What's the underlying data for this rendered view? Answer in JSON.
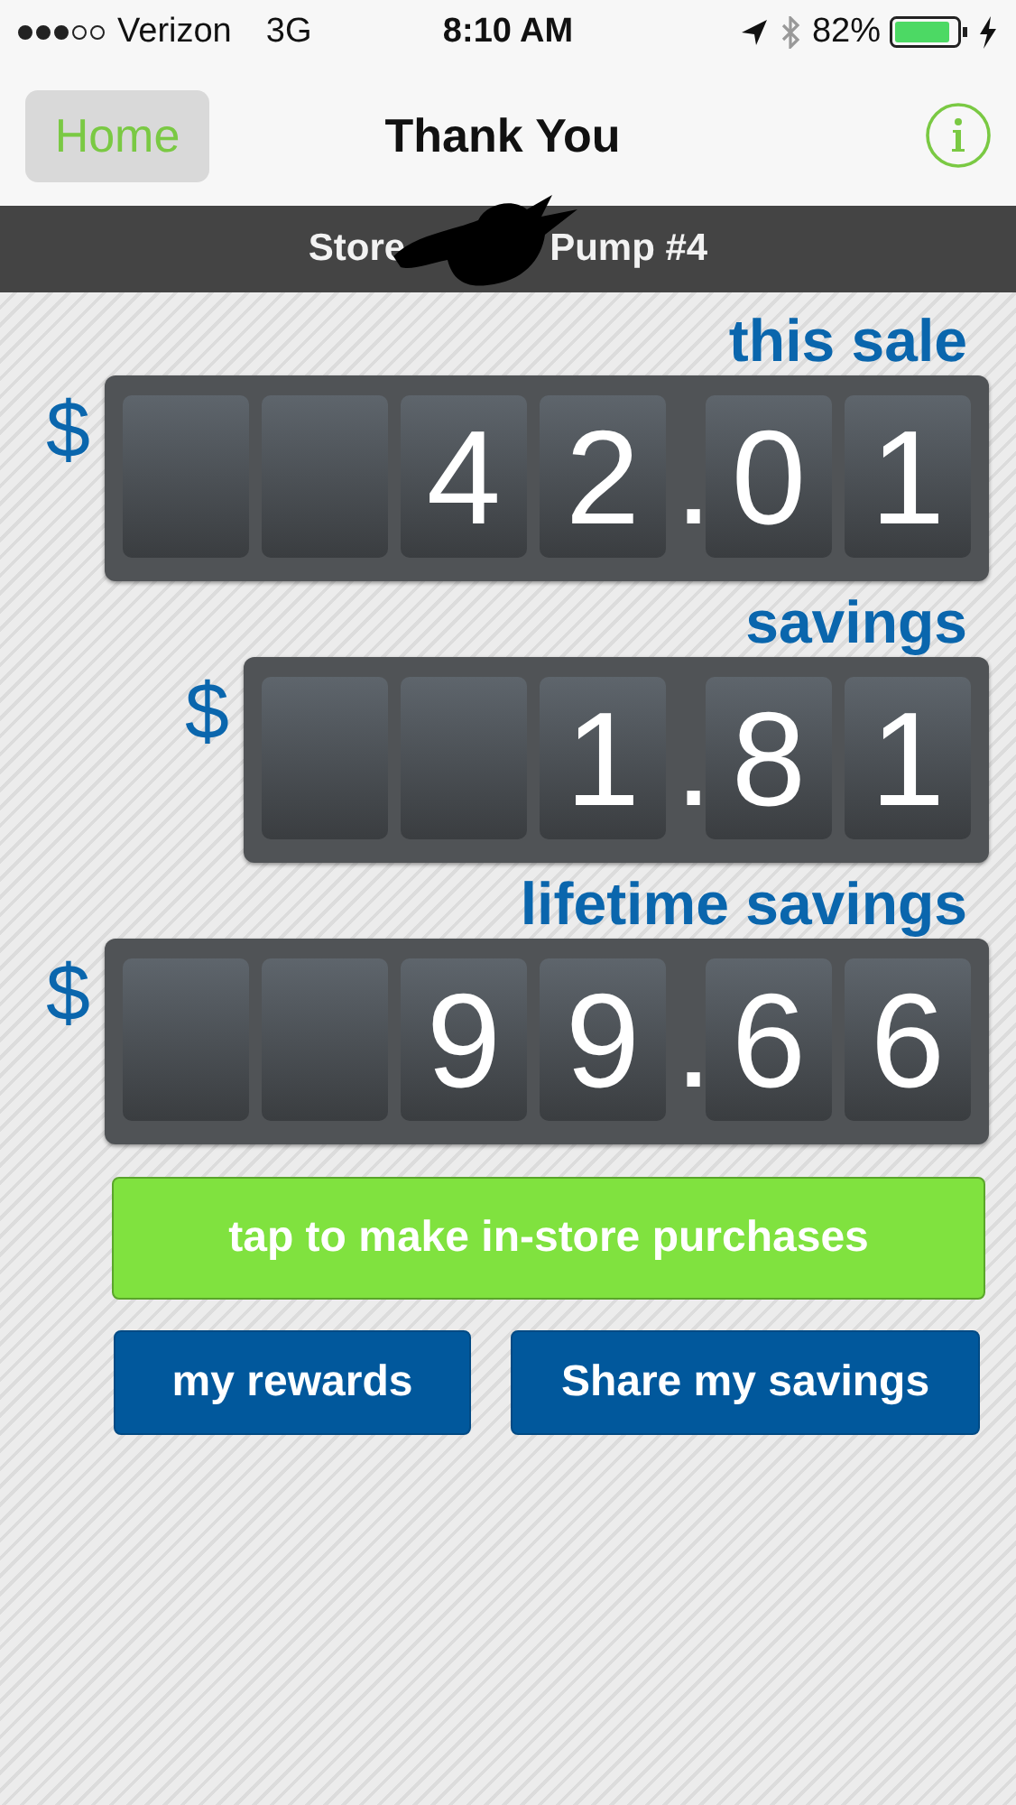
{
  "status_bar": {
    "signal_dots": [
      {
        "filled": true
      },
      {
        "filled": true
      },
      {
        "filled": true
      },
      {
        "filled": false
      },
      {
        "filled": false
      }
    ],
    "carrier": "Verizon",
    "network": "3G",
    "time": "8:10 AM",
    "battery_percent": "82%"
  },
  "nav_bar": {
    "back_button": "Home",
    "title": "Thank You"
  },
  "location_bar": {
    "store": "Store",
    "pump": "Pump #4"
  },
  "counters": [
    {
      "label": "this sale",
      "currency": "$",
      "tiles": [
        {
          "kind": "blank"
        },
        {
          "kind": "blank"
        },
        {
          "kind": "digit",
          "text": "4"
        },
        {
          "kind": "digit",
          "text": "2"
        },
        {
          "kind": "point",
          "text": "."
        },
        {
          "kind": "digit",
          "text": "0"
        },
        {
          "kind": "digit",
          "text": "1"
        }
      ]
    },
    {
      "label": "savings",
      "currency": "$",
      "tiles": [
        {
          "kind": "blank"
        },
        {
          "kind": "blank"
        },
        {
          "kind": "digit",
          "text": "1"
        },
        {
          "kind": "point",
          "text": "."
        },
        {
          "kind": "digit",
          "text": "8"
        },
        {
          "kind": "digit",
          "text": "1"
        }
      ]
    },
    {
      "label": "lifetime savings",
      "currency": "$",
      "tiles": [
        {
          "kind": "blank"
        },
        {
          "kind": "blank"
        },
        {
          "kind": "digit",
          "text": "9"
        },
        {
          "kind": "digit",
          "text": "9"
        },
        {
          "kind": "point",
          "text": "."
        },
        {
          "kind": "digit",
          "text": "6"
        },
        {
          "kind": "digit",
          "text": "6"
        }
      ]
    }
  ],
  "buttons": [
    {
      "label": "tap to make in-store purchases",
      "kind": "primary"
    },
    {
      "label": "my rewards",
      "kind": "secondary"
    },
    {
      "label": "Share my savings",
      "kind": "secondary"
    }
  ]
}
